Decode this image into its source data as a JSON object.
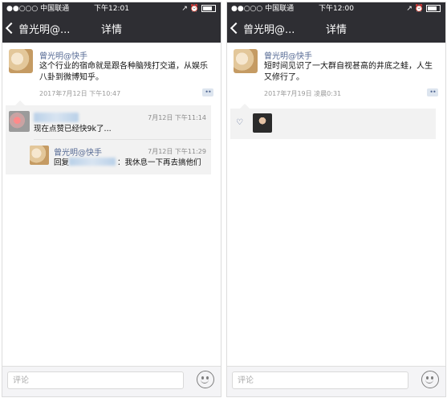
{
  "left": {
    "status": {
      "carrier": "●●○○○ 中国联通",
      "time": "下午12:01",
      "icons": "↗ ⏰"
    },
    "nav": {
      "back_label": "曾光明@...",
      "title": "详情"
    },
    "post": {
      "author": "曾光明@快手",
      "text": "这个行业的宿命就是跟各种脑残打交道，从娱乐八卦到微博知乎。",
      "time": "2017年7月12日 下午10:47",
      "more": "••"
    },
    "comments": [
      {
        "time": "7月12日 下午11:14",
        "text": "现在点赞已经快9k了..."
      },
      {
        "name": "曾光明@快手",
        "time": "7月12日 下午11:29",
        "reply_prefix": "回复",
        "text": "：我休息一下再去搞他们"
      }
    ],
    "input_placeholder": "评论"
  },
  "right": {
    "status": {
      "carrier": "●●○○○ 中国联通",
      "time": "下午12:00",
      "icons": "↗ ⏰"
    },
    "nav": {
      "back_label": "曾光明@...",
      "title": "详情"
    },
    "post": {
      "author": "曾光明@快手",
      "text": "短时间见识了一大群自视甚高的井底之蛙，人生又修行了。",
      "time": "2017年7月19日 凌晨0:31",
      "more": "••"
    },
    "like_icon": "♡",
    "input_placeholder": "评论"
  }
}
